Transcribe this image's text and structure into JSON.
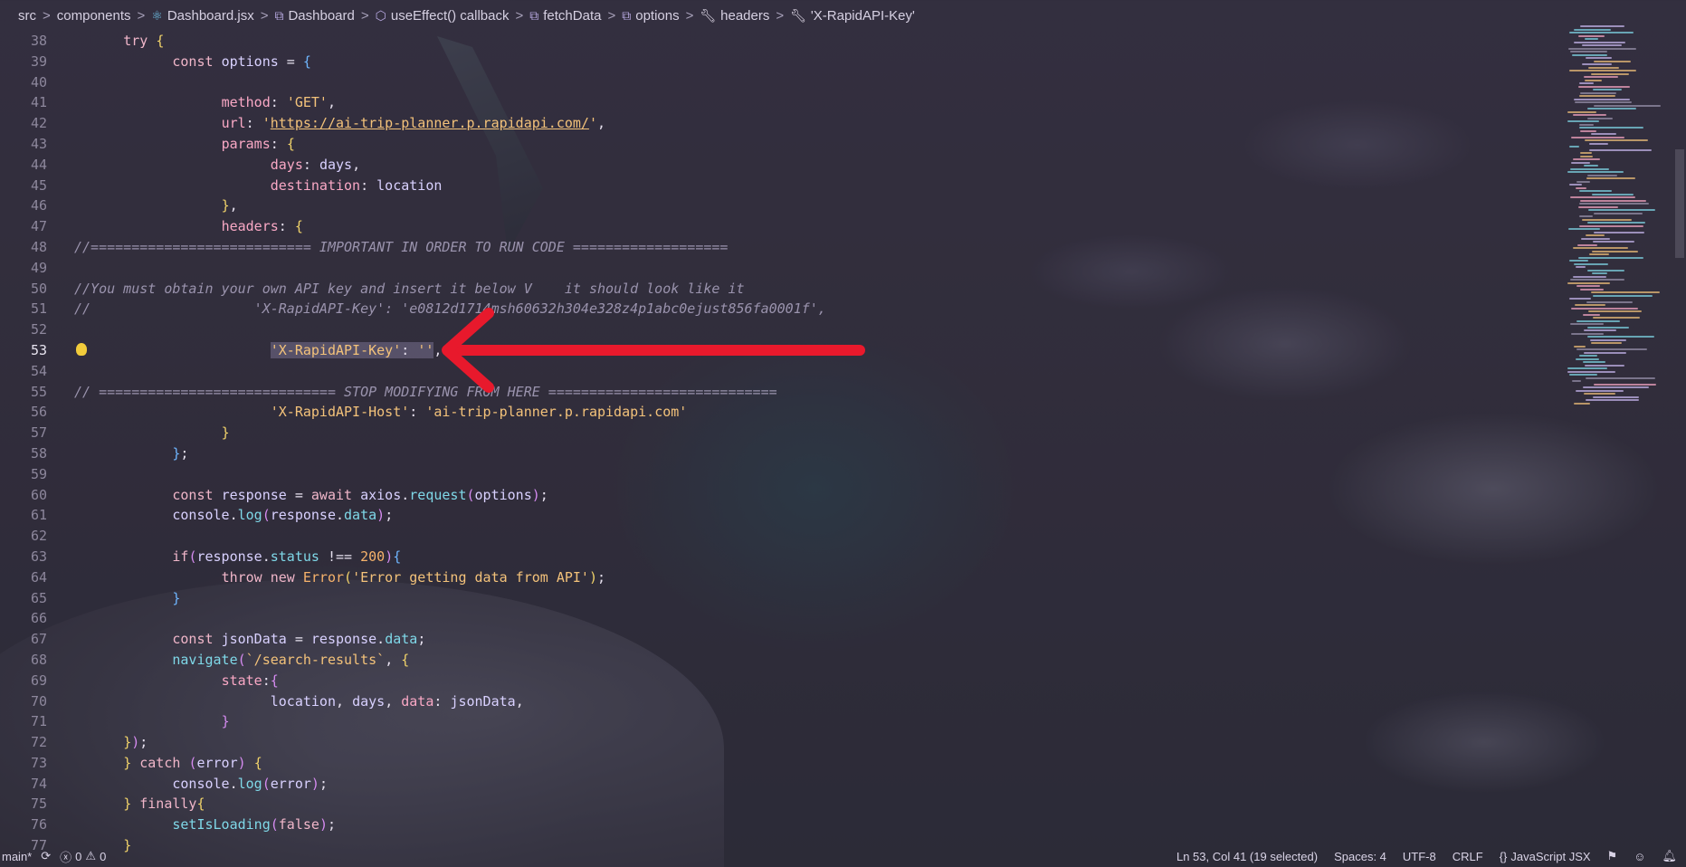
{
  "breadcrumb": [
    {
      "label": "src",
      "icon": ""
    },
    {
      "label": "components",
      "icon": ""
    },
    {
      "label": "Dashboard.jsx",
      "icon": "react-icon"
    },
    {
      "label": "Dashboard",
      "icon": "symbol-variable-icon"
    },
    {
      "label": "useEffect() callback",
      "icon": "cube-icon"
    },
    {
      "label": "fetchData",
      "icon": "symbol-variable-icon"
    },
    {
      "label": "options",
      "icon": "symbol-variable-icon"
    },
    {
      "label": "headers",
      "icon": "wrench-icon"
    },
    {
      "label": "'X-RapidAPI-Key'",
      "icon": "wrench-icon"
    }
  ],
  "line_numbers": [
    "38",
    "39",
    "40",
    "41",
    "42",
    "43",
    "44",
    "45",
    "46",
    "47",
    "48",
    "49",
    "50",
    "51",
    "52",
    "53",
    "54",
    "55",
    "56",
    "57",
    "58",
    "59",
    "60",
    "61",
    "62",
    "63",
    "64",
    "65",
    "66",
    "67",
    "68",
    "69",
    "70",
    "71",
    "72",
    "73",
    "74",
    "75",
    "76",
    "77"
  ],
  "code": {
    "l38_try": "try",
    "l39_const": "const",
    "l39_options": "options",
    "l41_method": "method",
    "l41_val": "'GET'",
    "l42_url": "url",
    "l42_val": "https://ai-trip-planner.p.rapidapi.com/",
    "l43_params": "params",
    "l44_days": "days",
    "l44_val": "days",
    "l45_destination": "destination",
    "l45_val": "location",
    "l47_headers": "headers",
    "l48_comment": "//=========================== IMPORTANT IN ORDER TO RUN CODE ===================",
    "l50_comment": "//You must obtain your own API key and insert it below V    it should look like it",
    "l51_comment": "//                    'X-RapidAPI-Key': 'e0812d1714msh60632h304e328z4p1abc0ejust856fa0001f',",
    "l53_key": "'X-RapidAPI-Key'",
    "l53_val": "''",
    "l55_comment": "// ============================= STOP MODIFYING FROM HERE ============================",
    "l56_key": "'X-RapidAPI-Host'",
    "l56_val": "'ai-trip-planner.p.rapidapi.com'",
    "l60_const": "const",
    "l60_response": "response",
    "l60_await": "await",
    "l60_axios": "axios",
    "l60_request": "request",
    "l60_options": "options",
    "l61_console": "console",
    "l61_log": "log",
    "l61_response": "response",
    "l61_data": "data",
    "l63_if": "if",
    "l63_response": "response",
    "l63_status": "status",
    "l63_num": "200",
    "l64_throw": "throw",
    "l64_new": "new",
    "l64_Error": "Error",
    "l64_msg": "'Error getting data from API'",
    "l67_const": "const",
    "l67_jsonData": "jsonData",
    "l67_response": "response",
    "l67_data": "data",
    "l68_navigate": "navigate",
    "l68_path": "`/search-results`",
    "l69_state": "state",
    "l70_location": "location",
    "l70_days": "days",
    "l70_data": "data",
    "l70_jsonData": "jsonData",
    "l73_catch": "catch",
    "l73_error": "error",
    "l74_console": "console",
    "l74_log": "log",
    "l74_error": "error",
    "l75_finally": "finally",
    "l76_set": "setIsLoading",
    "l76_false": "false"
  },
  "status": {
    "branch": "main*",
    "errors": "0",
    "warnings": "0",
    "position": "Ln 53, Col 41 (19 selected)",
    "spaces": "Spaces: 4",
    "encoding": "UTF-8",
    "eol": "CRLF",
    "language_icon": "{}",
    "language": "JavaScript JSX"
  },
  "colors": {
    "arrow": "#e8192c",
    "lightbulb": "#f2cc3b"
  }
}
